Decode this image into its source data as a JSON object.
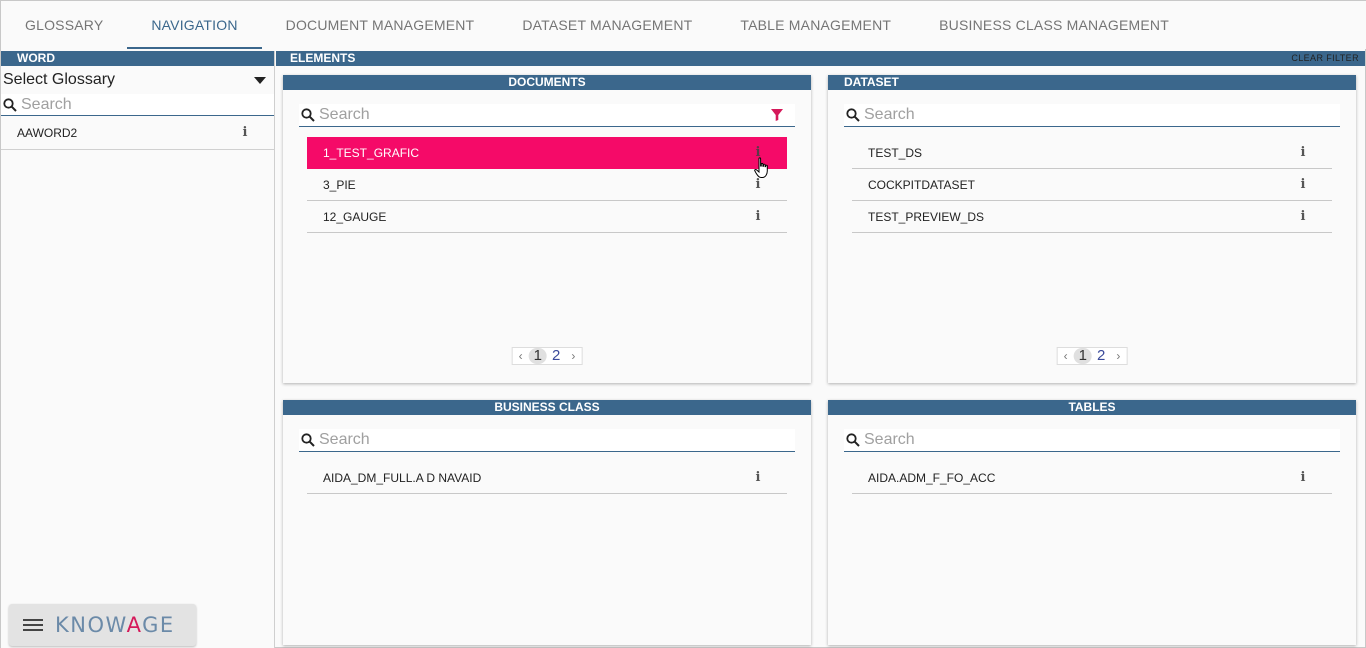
{
  "tabs": [
    {
      "label": "GLOSSARY",
      "active": false
    },
    {
      "label": "NAVIGATION",
      "active": true
    },
    {
      "label": "DOCUMENT MANAGEMENT",
      "active": false
    },
    {
      "label": "DATASET MANAGEMENT",
      "active": false
    },
    {
      "label": "TABLE MANAGEMENT",
      "active": false
    },
    {
      "label": "BUSINESS CLASS MANAGEMENT",
      "active": false
    }
  ],
  "word_panel": {
    "header": "WORD",
    "select_value": "Select Glossary",
    "search_placeholder": "Search",
    "items": [
      {
        "label": "AAWORD2"
      }
    ]
  },
  "elements": {
    "header": "ELEMENTS",
    "clear_filter": "CLEAR FILTER",
    "documents": {
      "header": "DOCUMENTS",
      "search_placeholder": "Search",
      "items": [
        {
          "label": "1_TEST_GRAFIC",
          "selected": true
        },
        {
          "label": "3_PIE",
          "selected": false
        },
        {
          "label": "12_GAUGE",
          "selected": false
        }
      ],
      "pager": {
        "prev": "‹",
        "pages": [
          "1",
          "2"
        ],
        "current": "1",
        "next": "›"
      }
    },
    "dataset": {
      "header": "DATASET",
      "search_placeholder": "Search",
      "items": [
        {
          "label": "TEST_DS"
        },
        {
          "label": "COCKPITDATASET"
        },
        {
          "label": "TEST_PREVIEW_DS"
        }
      ],
      "pager": {
        "prev": "‹",
        "pages": [
          "1",
          "2"
        ],
        "current": "1",
        "next": "›"
      }
    },
    "business_class": {
      "header": "BUSINESS CLASS",
      "search_placeholder": "Search",
      "items": [
        {
          "label": "AIDA_DM_FULL.A D NAVAID"
        }
      ]
    },
    "tables": {
      "header": "TABLES",
      "search_placeholder": "Search",
      "items": [
        {
          "label": "AIDA.ADM_F_FO_ACC"
        }
      ]
    }
  },
  "brand": {
    "logo_pre": "KNOW",
    "logo_accent": "A",
    "logo_post": "GE"
  },
  "icons": {
    "search": "search-icon",
    "info": "info-icon",
    "filter": "filter-icon",
    "dropdown": "caret-down-icon",
    "menu": "hamburger-icon"
  },
  "colors": {
    "header_bar": "#3b678c",
    "selected_row": "#f50a68",
    "filter_icon": "#d5195a",
    "active_tab": "#3b678c"
  }
}
